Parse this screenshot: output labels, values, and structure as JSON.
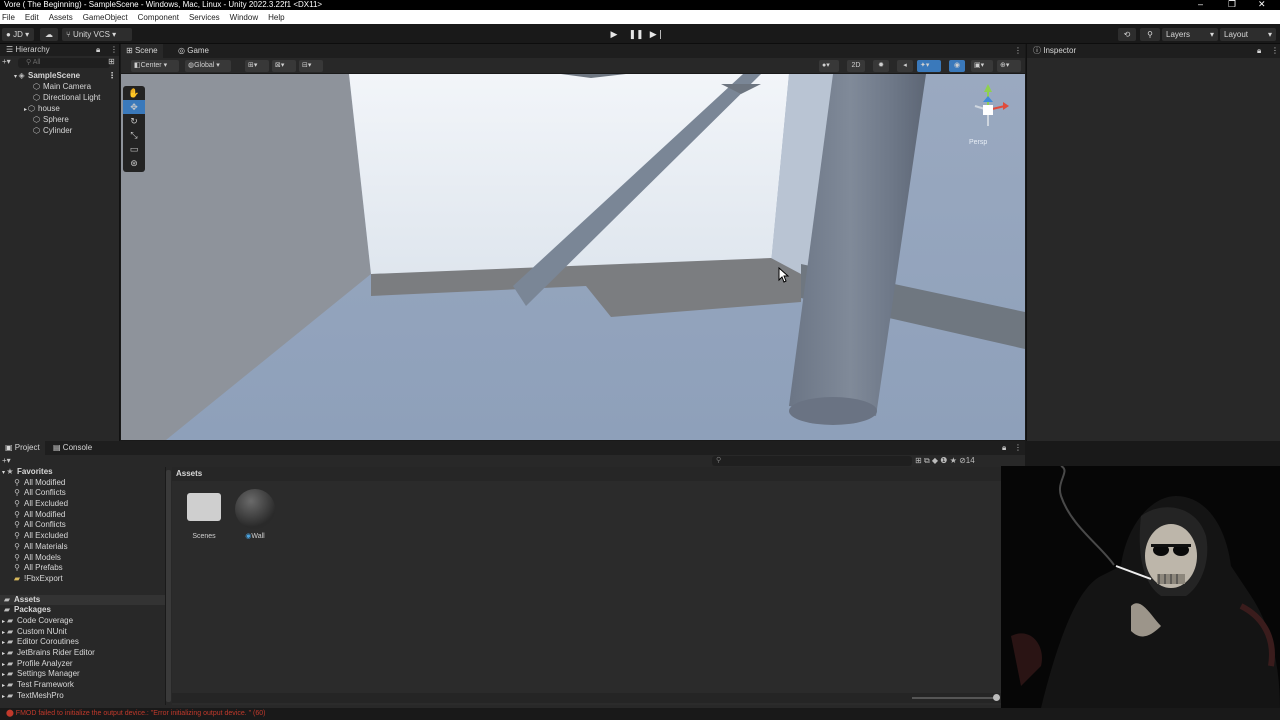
{
  "window": {
    "title": "Vore ( The Beginning) - SampleScene - Windows, Mac, Linux - Unity 2022.3.22f1 <DX11>",
    "controls": [
      "–",
      "❐",
      "✕"
    ]
  },
  "menu": [
    "File",
    "Edit",
    "Assets",
    "GameObject",
    "Component",
    "Services",
    "Window",
    "Help"
  ],
  "toolbar": {
    "account": "JD",
    "vcs": "Unity VCS",
    "layers": "Layers",
    "layout": "Layout"
  },
  "hierarchy": {
    "tab": "Hierarchy",
    "search_placeholder": "All",
    "scene": "SampleScene",
    "items": [
      "Main Camera",
      "Directional Light",
      "house",
      "Sphere",
      "Cylinder"
    ]
  },
  "scene_tabs": {
    "scene": "Scene",
    "game": "Game"
  },
  "scene_tools": {
    "pivot": "Center",
    "space": "Global",
    "mode_2d": "2D"
  },
  "gizmo": {
    "persp_label": "Persp"
  },
  "inspector": {
    "tab": "Inspector"
  },
  "bottom_tabs": {
    "project": "Project",
    "console": "Console",
    "hidden_count": "14"
  },
  "project": {
    "favorites_label": "Favorites",
    "favorites": [
      "All Modified",
      "All Conflicts",
      "All Excluded",
      "All Modified",
      "All Conflicts",
      "All Excluded",
      "All Materials",
      "All Models",
      "All Prefabs",
      "!FbxExport"
    ],
    "assets_label": "Assets",
    "packages_label": "Packages",
    "packages": [
      "Code Coverage",
      "Custom NUnit",
      "Editor Coroutines",
      "JetBrains Rider Editor",
      "Profile Analyzer",
      "Settings Manager",
      "Test Framework",
      "TextMeshPro"
    ],
    "breadcrumb": "Assets",
    "items": [
      {
        "name": "Scenes",
        "kind": "folder"
      },
      {
        "name": "Wall",
        "kind": "material"
      }
    ]
  },
  "status": {
    "error": "FMOD failed to initialize the output device.: \"Error initializing output device. \" (60)"
  },
  "colors": {
    "accent": "#3a79bb",
    "panel": "#282828",
    "error": "#c0392b"
  }
}
